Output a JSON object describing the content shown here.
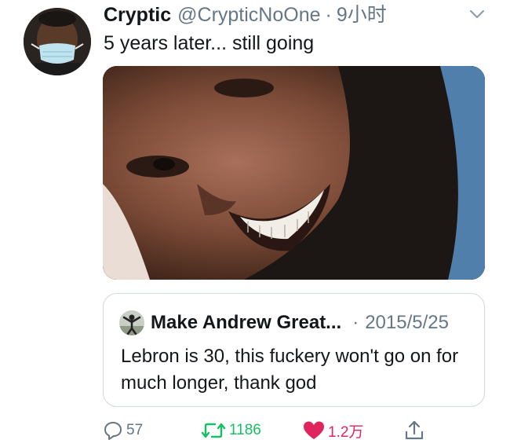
{
  "tweet": {
    "display_name": "Cryptic",
    "handle": "@CrypticNoOne",
    "separator": "·",
    "time": "9小时",
    "text": "5 years later... still going",
    "avatar_icon": "profile-photo-masked-man",
    "media_description_icon": "photo-smiling-bearded-man"
  },
  "quote": {
    "display_name": "Make Andrew Great...",
    "separator": "·",
    "date": "2015/5/25",
    "text": "Lebron is 30, this fuckery won't go on for much longer, thank god"
  },
  "actions": {
    "reply_count": "57",
    "retweet_count": "1186",
    "like_count": "1.2万",
    "colors": {
      "retweet": "#17bf63",
      "like": "#e0245e",
      "muted": "#657786"
    }
  }
}
